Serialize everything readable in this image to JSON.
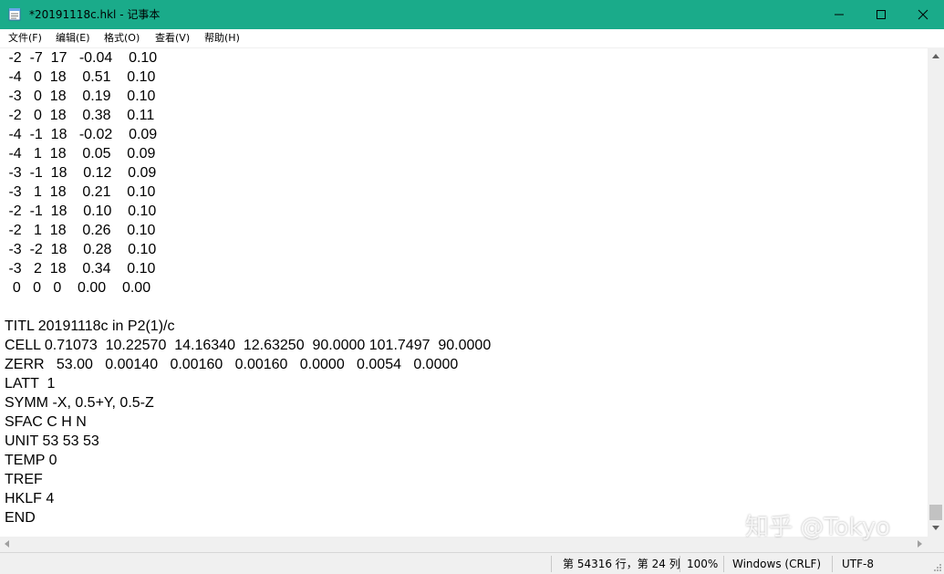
{
  "window": {
    "title": "*20191118c.hkl - 记事本",
    "accent_color": "#1aab8a"
  },
  "menu": [
    "文件(F)",
    "编辑(E)",
    "格式(O)",
    "查看(V)",
    "帮助(H)"
  ],
  "editor": {
    "lines": [
      " -2  -7  17   -0.04    0.10",
      " -4   0  18    0.51    0.10",
      " -3   0  18    0.19    0.10",
      " -2   0  18    0.38    0.11",
      " -4  -1  18   -0.02    0.09",
      " -4   1  18    0.05    0.09",
      " -3  -1  18    0.12    0.09",
      " -3   1  18    0.21    0.10",
      " -2  -1  18    0.10    0.10",
      " -2   1  18    0.26    0.10",
      " -3  -2  18    0.28    0.10",
      " -3   2  18    0.34    0.10",
      "  0   0   0    0.00    0.00",
      "",
      "TITL 20191118c in P2(1)/c",
      "CELL 0.71073  10.22570  14.16340  12.63250  90.0000 101.7497  90.0000",
      "ZERR   53.00   0.00140   0.00160   0.00160   0.0000   0.0054   0.0000",
      "LATT  1",
      "SYMM -X, 0.5+Y, 0.5-Z",
      "SFAC C H N",
      "UNIT 53 53 53",
      "TEMP 0",
      "TREF",
      "HKLF 4",
      "END"
    ]
  },
  "statusbar": {
    "position": "第 54316 行，第 24 列",
    "zoom": "100%",
    "line_ending": "Windows (CRLF)",
    "encoding": "UTF-8"
  },
  "watermark": "知乎 @Tokyo"
}
